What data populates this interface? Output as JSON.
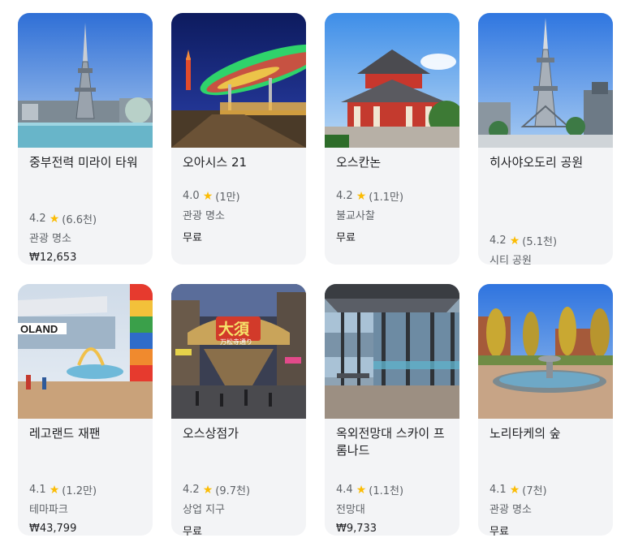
{
  "places": [
    {
      "title": "중부전력 미라이 타워",
      "rating": "4.2",
      "reviews": "(6.6천)",
      "category": "관광 명소",
      "price": "₩12,653"
    },
    {
      "title": "오아시스 21",
      "rating": "4.0",
      "reviews": "(1만)",
      "category": "관광 명소",
      "price": "무료"
    },
    {
      "title": "오스칸논",
      "rating": "4.2",
      "reviews": "(1.1만)",
      "category": "불교사찰",
      "price": "무료"
    },
    {
      "title": "히사야오도리 공원",
      "rating": "4.2",
      "reviews": "(5.1천)",
      "category": "시티 공원",
      "price": ""
    },
    {
      "title": "레고랜드 재팬",
      "rating": "4.1",
      "reviews": "(1.2만)",
      "category": "테마파크",
      "price": "₩43,799"
    },
    {
      "title": "오스상점가",
      "rating": "4.2",
      "reviews": "(9.7천)",
      "category": "상업 지구",
      "price": "무료"
    },
    {
      "title": "옥외전망대 스카이 프롬나드",
      "rating": "4.4",
      "reviews": "(1.1천)",
      "category": "전망대",
      "price": "₩9,733"
    },
    {
      "title": "노리타케의 숲",
      "rating": "4.1",
      "reviews": "(7천)",
      "category": "관광 명소",
      "price": "무료"
    }
  ],
  "photo_text": {
    "legoland_sign": "OLAND",
    "shopping_street_sign": "大須",
    "shopping_street_sub": "万松寺通り"
  },
  "star_icon": "star-icon",
  "colors": {
    "star": "#fbbc04",
    "card_bg": "#f3f4f6",
    "text_primary": "#202124",
    "text_secondary": "#5f6368"
  }
}
